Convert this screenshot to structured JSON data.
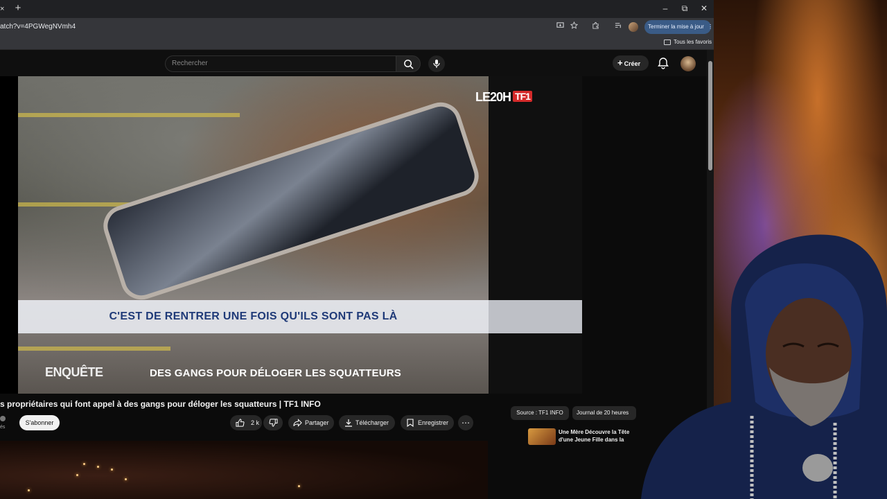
{
  "browser": {
    "url": "atch?v=4PGWegNVmh4",
    "update_button": "Terminer la mise à jour",
    "bookmarks_label": "Tous les favoris",
    "new_tab_symbol": "+",
    "close_tab_symbol": "×",
    "window_controls": {
      "minimize": "–",
      "restore": "⧉",
      "close": "✕"
    }
  },
  "youtube": {
    "search_placeholder": "Rechercher",
    "create_label": "Créer"
  },
  "video": {
    "logo_le20h": "LE20H",
    "logo_tf1": "TF1",
    "quote_text": "C'EST DE RENTRER UNE FOIS QU'ILS SONT PAS LÀ",
    "show_name": "ENQUÊTE",
    "banner_text": "DES GANGS POUR DÉLOGER LES SQUATTEURS",
    "title": "s propriétaires qui font appel à des gangs pour déloger les squatteurs | TF1 INFO",
    "channel_subs_fragment": "és",
    "subscribe_label": "S'abonner",
    "like_count": "2 k",
    "share_label": "Partager",
    "download_label": "Télécharger",
    "save_label": "Enregistrer"
  },
  "sidebar": {
    "chip_source": "Source : TF1 INFO",
    "chip_journal": "Journal de 20 heures",
    "suggested_title": "Une Mère Découvre la Tête d'une Jeune Fille dans la"
  },
  "colors": {
    "accent_update": "#3a5b86",
    "quote_text": "#1f3a78",
    "tf1_red": "#d42a2a"
  }
}
